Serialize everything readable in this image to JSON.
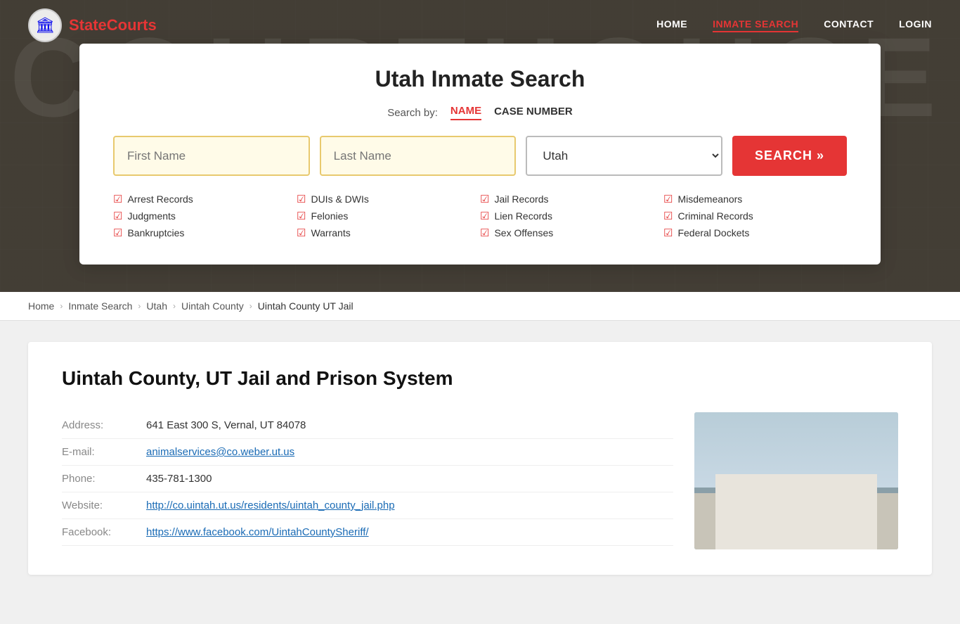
{
  "site": {
    "name_part1": "State",
    "name_part2": "Courts"
  },
  "nav": {
    "home": "HOME",
    "inmate_search": "INMATE SEARCH",
    "contact": "CONTACT",
    "login": "LOGIN"
  },
  "hero_text": "COURTHOUSE",
  "search_card": {
    "title": "Utah Inmate Search",
    "search_by_label": "Search by:",
    "tab_name": "NAME",
    "tab_case": "CASE NUMBER",
    "first_name_placeholder": "First Name",
    "last_name_placeholder": "Last Name",
    "state_value": "Utah",
    "search_button": "SEARCH »",
    "checks": [
      "Arrest Records",
      "DUIs & DWIs",
      "Jail Records",
      "Misdemeanors",
      "Judgments",
      "Felonies",
      "Lien Records",
      "Criminal Records",
      "Bankruptcies",
      "Warrants",
      "Sex Offenses",
      "Federal Dockets"
    ]
  },
  "breadcrumb": {
    "home": "Home",
    "inmate_search": "Inmate Search",
    "utah": "Utah",
    "uintah_county": "Uintah County",
    "current": "Uintah County UT Jail"
  },
  "facility": {
    "title": "Uintah County, UT Jail and Prison System",
    "address_label": "Address:",
    "address_value": "641 East 300 S, Vernal, UT 84078",
    "email_label": "E-mail:",
    "email_value": "animalservices@co.weber.ut.us",
    "phone_label": "Phone:",
    "phone_value": "435-781-1300",
    "website_label": "Website:",
    "website_value": "http://co.uintah.ut.us/residents/uintah_county_jail.php",
    "facebook_label": "Facebook:",
    "facebook_value": "https://www.facebook.com/UintahCountySheriff/"
  }
}
